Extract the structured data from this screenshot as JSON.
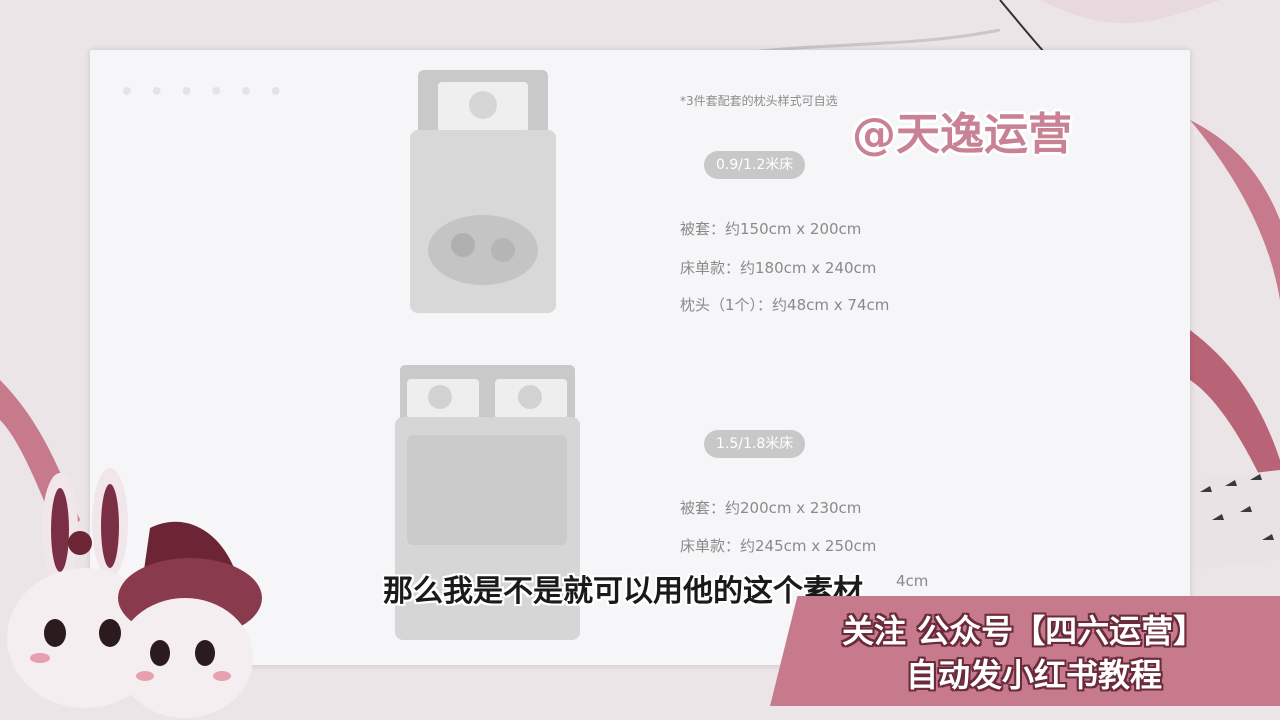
{
  "card": {
    "note": "*3件套配套的枕头样式可自选",
    "size_small": {
      "label": "0.9/1.2米床",
      "duvet": "被套：约150cm x 200cm",
      "sheet": "床单款：约180cm x 240cm",
      "pillow": "枕头（1个）：约48cm x 74cm"
    },
    "size_large": {
      "label": "1.5/1.8米床",
      "duvet": "被套：约200cm x 230cm",
      "sheet": "床单款：约245cm x 250cm",
      "pillow_partial": "4cm"
    }
  },
  "watermark": "@天逸运营",
  "subtitle": "那么我是不是就可以用他的这个素材",
  "banner": {
    "line1": "关注 公众号【四六运营】",
    "line2": "自动发小红书教程"
  },
  "colors": {
    "accent_pink": "#c67a8c",
    "dark_outline": "#6b2b3a"
  }
}
